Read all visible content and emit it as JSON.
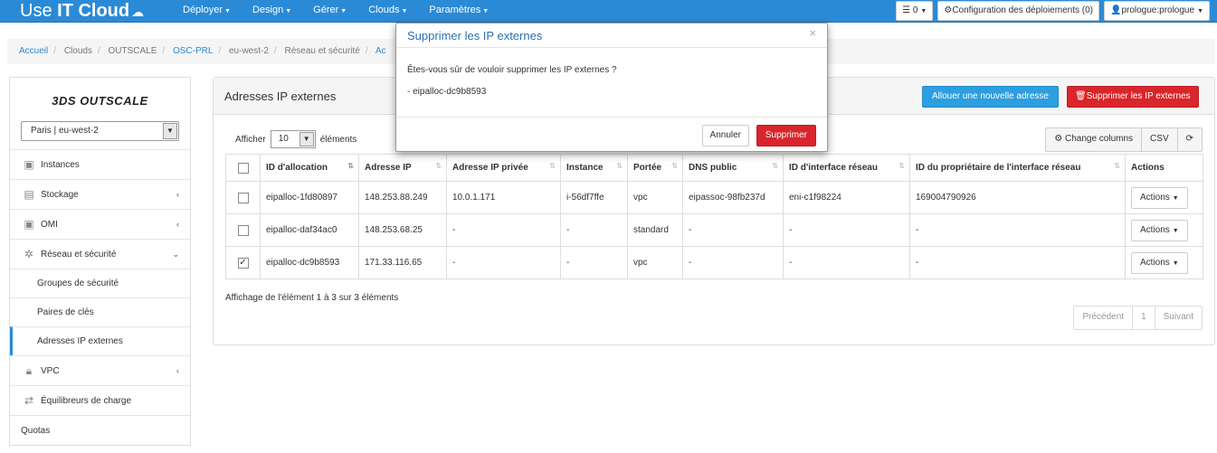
{
  "navbar": {
    "brand_light": "Use ",
    "brand_bold": "IT Cloud",
    "brand_icon": "cloud-upload-icon",
    "menu": [
      {
        "label": "Déployer"
      },
      {
        "label": "Design"
      },
      {
        "label": "Gérer"
      },
      {
        "label": "Clouds"
      },
      {
        "label": "Paramètres"
      }
    ],
    "jobs_count": "0",
    "config_label": "Configuration des déploiements (0)",
    "user_label": "prologue:prologue"
  },
  "breadcrumb": [
    "Accueil",
    "Clouds",
    "OUTSCALE",
    "OSC-PRL",
    "eu-west-2",
    "Réseau et sécurité",
    "Ac"
  ],
  "sidebar": {
    "logo": "3DS OUTSCALE",
    "region": "Paris | eu-west-2",
    "items": [
      {
        "label": "Instances",
        "icon": "chip-icon"
      },
      {
        "label": "Stockage",
        "icon": "storage-icon"
      },
      {
        "label": "OMI",
        "icon": "chip-icon"
      },
      {
        "label": "Réseau et sécurité",
        "icon": "network-icon"
      }
    ],
    "sub_items": [
      {
        "label": "Groupes de sécurité"
      },
      {
        "label": "Paires de clés"
      },
      {
        "label": "Adresses IP externes"
      }
    ],
    "bottom_items": [
      {
        "label": "VPC",
        "icon": "lock-icon"
      },
      {
        "label": "Équilibreurs de charge",
        "icon": "arrows-icon"
      },
      {
        "label": "Quotas"
      }
    ]
  },
  "panel": {
    "title": "Adresses IP externes",
    "add_button": "Allouer une nouvelle adresse",
    "delete_button": "Supprimer les IP externes",
    "show_label": "Afficher",
    "page_size": "10",
    "elements_label": "éléments",
    "change_columns": "Change columns",
    "csv": "CSV",
    "columns": [
      "ID d'allocation",
      "Adresse IP",
      "Adresse IP privée",
      "Instance",
      "Portée",
      "DNS public",
      "ID d'interface réseau",
      "ID du propriétaire de l'interface réseau",
      "Actions"
    ],
    "rows": [
      {
        "checked": false,
        "cells": [
          "eipalloc-1fd80897",
          "148.253.88.249",
          "10.0.1.171",
          "i-56df7ffe",
          "vpc",
          "eipassoc-98fb237d",
          "eni-c1f98224",
          "169004790926"
        ]
      },
      {
        "checked": false,
        "cells": [
          "eipalloc-daf34ac0",
          "148.253.68.25",
          "-",
          "-",
          "standard",
          "-",
          "-",
          "-"
        ]
      },
      {
        "checked": true,
        "cells": [
          "eipalloc-dc9b8593",
          "171.33.116.65",
          "-",
          "-",
          "vpc",
          "-",
          "-",
          "-"
        ]
      }
    ],
    "actions_label": "Actions",
    "info": "Affichage de l'élément 1 à 3 sur 3 éléments",
    "pager": {
      "prev": "Précédent",
      "page": "1",
      "next": "Suivant"
    }
  },
  "modal": {
    "title": "Supprimer les IP externes",
    "question": "Êtes-vous sûr de vouloir supprimer les IP externes ?",
    "item": "- eipalloc-dc9b8593",
    "cancel": "Annuler",
    "confirm": "Supprimer"
  }
}
